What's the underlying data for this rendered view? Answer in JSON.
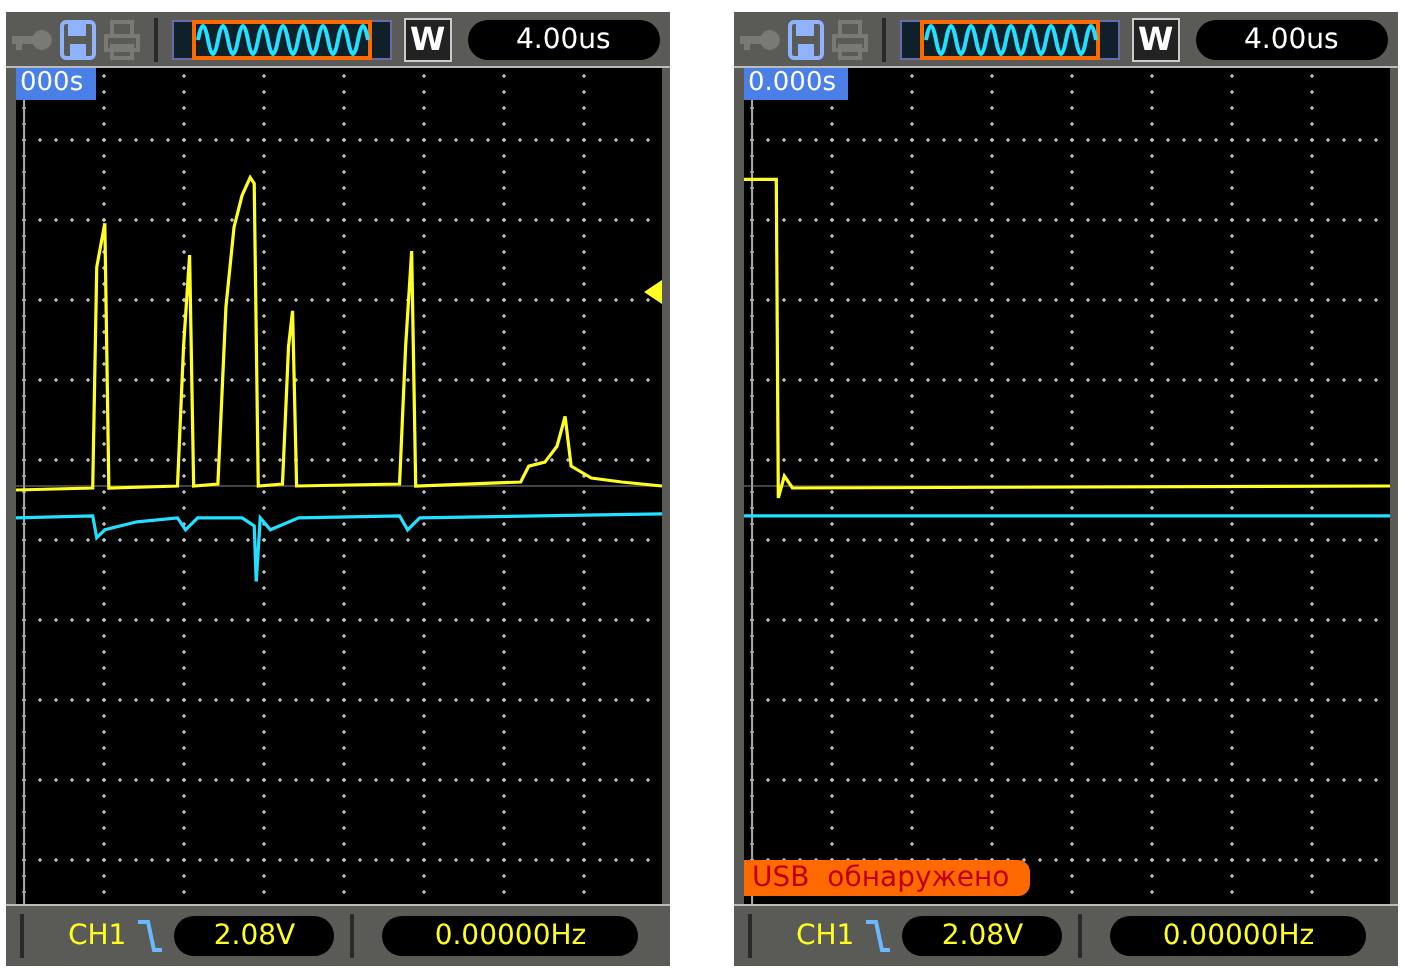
{
  "screens": [
    {
      "time_offset": "000s",
      "timebase": "4.00us",
      "mode": "W",
      "channel": "CH1",
      "trigger_level": "2.08V",
      "frequency": "0.00000Hz",
      "kind": "pulses"
    },
    {
      "time_offset": "0.000s",
      "timebase": "4.00us",
      "mode": "W",
      "channel": "CH1",
      "trigger_level": "2.08V",
      "frequency": "0.00000Hz",
      "kind": "step",
      "notice": "USB  обнаружено"
    }
  ]
}
